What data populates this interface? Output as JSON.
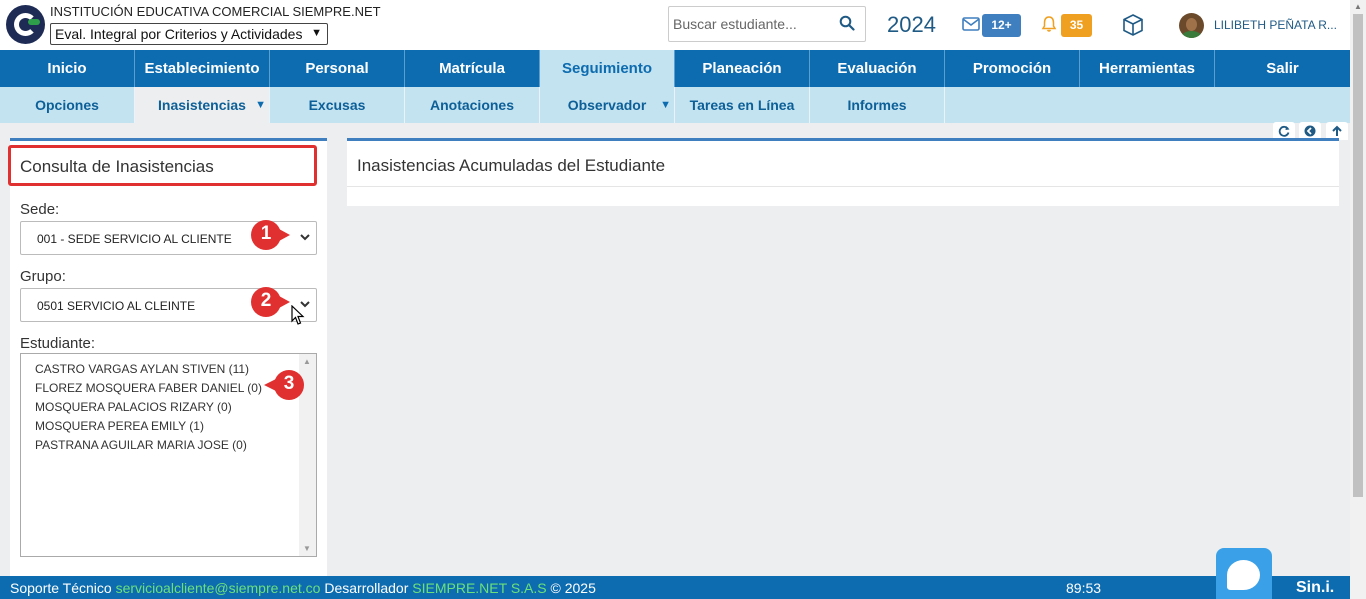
{
  "header": {
    "institution": "INSTITUCIÓN EDUCATIVA COMERCIAL SIEMPRE.NET",
    "eval_select": "Eval. Integral por Criterios y Actividades",
    "search_placeholder": "Buscar estudiante...",
    "year": "2024",
    "messages_badge": "12+",
    "notifications_badge": "35",
    "user_name": "LILIBETH PEÑATA R..."
  },
  "main_nav": [
    {
      "label": "Inicio"
    },
    {
      "label": "Establecimiento"
    },
    {
      "label": "Personal"
    },
    {
      "label": "Matrícula"
    },
    {
      "label": "Seguimiento",
      "active": true
    },
    {
      "label": "Planeación"
    },
    {
      "label": "Evaluación"
    },
    {
      "label": "Promoción"
    },
    {
      "label": "Herramientas"
    },
    {
      "label": "Salir"
    }
  ],
  "sub_nav": [
    {
      "label": "Opciones"
    },
    {
      "label": "Inasistencias",
      "active": true,
      "dropdown": true
    },
    {
      "label": "Excusas"
    },
    {
      "label": "Anotaciones"
    },
    {
      "label": "Observador",
      "dropdown": true
    },
    {
      "label": "Tareas en Línea"
    },
    {
      "label": "Informes"
    }
  ],
  "left_panel": {
    "title": "Consulta de Inasistencias",
    "sede_label": "Sede:",
    "sede_value": "001 - SEDE SERVICIO AL CLIENTE",
    "grupo_label": "Grupo:",
    "grupo_value": "0501 SERVICIO AL CLEINTE",
    "estudiante_label": "Estudiante:",
    "students": [
      "CASTRO VARGAS AYLAN STIVEN (11)",
      "FLOREZ MOSQUERA FABER DANIEL (0)",
      "MOSQUERA PALACIOS RIZARY (0)",
      "MOSQUERA PEREA EMILY (1)",
      "PASTRANA AGUILAR MARIA JOSE (0)"
    ]
  },
  "markers": [
    "1",
    "2",
    "3"
  ],
  "right_panel": {
    "title": "Inasistencias Acumuladas  del Estudiante"
  },
  "footer": {
    "support_label": "Soporte Técnico",
    "support_email": "servicioalcliente@siempre.net.co",
    "dev_label": "Desarrollador",
    "dev_name": "SIEMPRE.NET S.A.S",
    "copyright": "© 2025",
    "timer": "89:53",
    "brand": "Sin.i."
  },
  "colors": {
    "primary": "#0d6cb0",
    "subnav": "#c3e3f0",
    "marker": "#e03030",
    "highlight_border": "#e03030",
    "badge_blue": "#3f7fbf",
    "badge_orange": "#f0a020"
  }
}
